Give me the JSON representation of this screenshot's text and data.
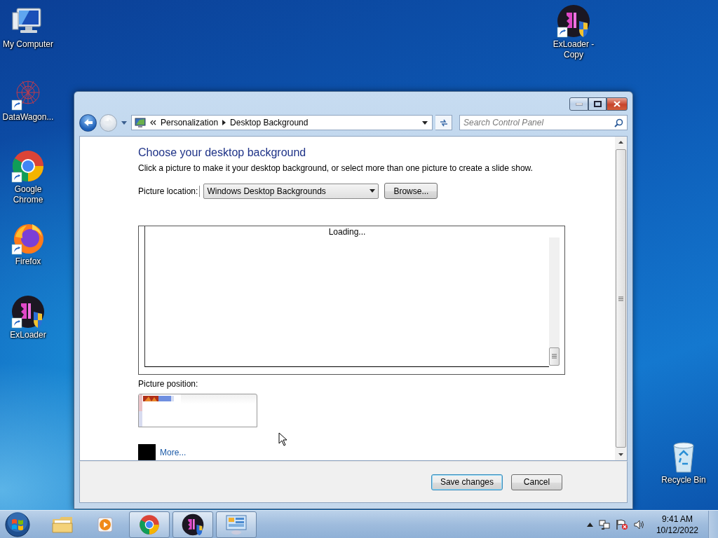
{
  "desktop_icons": [
    {
      "label": "My Computer",
      "kind": "computer",
      "shortcut": false
    },
    {
      "label": "DataWagon...",
      "kind": "network",
      "shortcut": true
    },
    {
      "label": "Google Chrome",
      "kind": "chrome",
      "shortcut": true
    },
    {
      "label": "Firefox",
      "kind": "firefox",
      "shortcut": true
    },
    {
      "label": "ExLoader",
      "kind": "exloader",
      "shortcut": true
    },
    {
      "label": "ExLoader - Copy",
      "kind": "exloader",
      "shortcut": true
    },
    {
      "label": "Recycle Bin",
      "kind": "recycle",
      "shortcut": false
    }
  ],
  "window": {
    "address": {
      "crumbs": [
        "Personalization",
        "Desktop Background"
      ]
    },
    "search": {
      "placeholder": "Search Control Panel"
    },
    "content": {
      "heading": "Choose your desktop background",
      "description": "Click a picture to make it your desktop background, or select more than one picture to create a slide show.",
      "location_label": "Picture location:",
      "location_value": "Windows Desktop Backgrounds",
      "browse": "Browse...",
      "loading": "Loading...",
      "position_label": "Picture position:",
      "more_link": "More..."
    },
    "buttons": [
      {
        "label": "Save changes",
        "default": true
      },
      {
        "label": "Cancel",
        "default": false
      }
    ]
  },
  "taskbar": {
    "items": [
      {
        "kind": "explorer",
        "running": false
      },
      {
        "kind": "media",
        "running": false
      },
      {
        "kind": "chrome",
        "running": true
      },
      {
        "kind": "exloader",
        "running": true
      },
      {
        "kind": "controlpanel",
        "running": true
      }
    ],
    "clock": {
      "time": "9:41 AM",
      "date": "10/12/2022"
    }
  }
}
